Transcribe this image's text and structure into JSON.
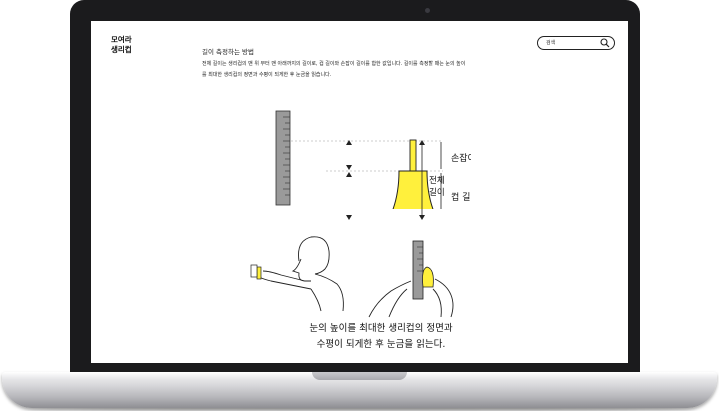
{
  "site": {
    "logo_line1": "모여라",
    "logo_line2": "생리컵"
  },
  "search": {
    "placeholder": "검색",
    "icon": "search-icon"
  },
  "section": {
    "title": "길이 측정하는 방법",
    "desc_line1": "전체 길이는 생리컵의 맨 위 부터 맨 아래까지의 길이로, 컵 길이와 손잡이 길이를 합한 값입니다. 길이를 측정할 때는 눈의 높이",
    "desc_line2": "를 최대한 생리컵의 정면과 수평이 되게한 후 눈금을 읽습니다."
  },
  "diagram": {
    "handle_label": "손잡이 길이",
    "cup_label": "컵 길이",
    "total_label_line1": "전체",
    "total_label_line2": "길이",
    "cup_color": "#fff03c"
  },
  "caption": {
    "line1": "눈의 높이를 최대한 생리컵의 정면과",
    "line2": "수평이 되게한 후 눈금을 읽는다."
  }
}
